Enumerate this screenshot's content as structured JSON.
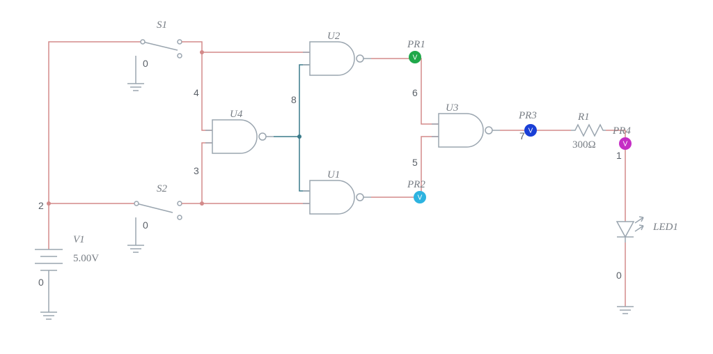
{
  "power": {
    "v1_name": "V1",
    "v1_value": "5.00V",
    "net2": "2",
    "net0": "0"
  },
  "switches": {
    "s1_name": "S1",
    "s1_net0": "0",
    "s2_name": "S2",
    "s2_net0": "0"
  },
  "gates": {
    "u1": "U1",
    "u2": "U2",
    "u3": "U3",
    "u4": "U4"
  },
  "nets": {
    "n3": "3",
    "n4": "4",
    "n5": "5",
    "n6": "6",
    "n7": "7",
    "n8": "8"
  },
  "probes": {
    "pr1": {
      "label": "PR1",
      "letter": "V",
      "color": "#1fa84a"
    },
    "pr2": {
      "label": "PR2",
      "letter": "V",
      "color": "#2db3e0"
    },
    "pr3": {
      "label": "PR3",
      "letter": "V",
      "color": "#1a3fd6"
    },
    "pr4": {
      "label": "PR4",
      "letter": "V",
      "color": "#c52ec5"
    }
  },
  "resistor": {
    "name": "R1",
    "value": "300Ω",
    "net_out": "1"
  },
  "led": {
    "name": "LED1",
    "net0": "0"
  }
}
